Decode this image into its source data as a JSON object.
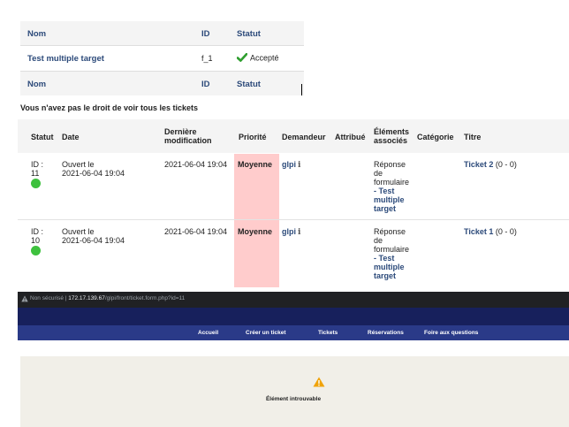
{
  "form_targets": {
    "header": {
      "name": "Nom",
      "id": "ID",
      "status": "Statut"
    },
    "rows": [
      {
        "name": "Test multiple target",
        "id": "f_1",
        "status": "Accepté"
      }
    ],
    "footer": {
      "name": "Nom",
      "id": "ID",
      "status": "Statut"
    }
  },
  "ticket_list": {
    "notice": "Vous n'avez pas le droit de voir tous les tickets",
    "columns": {
      "statut": "Statut",
      "date": "Date",
      "last_mod_1": "Dernière",
      "last_mod_2": "modification",
      "priority": "Priorité",
      "requester": "Demandeur",
      "assigned": "Attribué",
      "assoc_1": "Éléments",
      "assoc_2": "associés",
      "category": "Catégorie",
      "title": "Titre"
    },
    "rows": [
      {
        "id_label": "ID :",
        "id": "11",
        "status_color": "#3ec13e",
        "opened_label": "Ouvert le",
        "opened_date": "2021-06-04 19:04",
        "last_modified": "2021-06-04 19:04",
        "priority": "Moyenne",
        "requester": "glpi",
        "elements": [
          "Réponse",
          "de",
          "formulaire"
        ],
        "element_link": [
          "- Test",
          "multiple",
          "target"
        ],
        "title": "Ticket 2",
        "counts": "(0 - 0)"
      },
      {
        "id_label": "ID :",
        "id": "10",
        "status_color": "#3ec13e",
        "opened_label": "Ouvert le",
        "opened_date": "2021-06-04 19:04",
        "last_modified": "2021-06-04 19:04",
        "priority": "Moyenne",
        "requester": "glpi",
        "elements": [
          "Réponse",
          "de",
          "formulaire"
        ],
        "element_link": [
          "- Test",
          "multiple",
          "target"
        ],
        "title": "Ticket 1",
        "counts": "(0 - 0)"
      }
    ]
  },
  "browser": {
    "security": "Non sécurisé",
    "separator": "|",
    "host": "172.17.139.67",
    "path": "/glpi/front/ticket.form.php?id=11",
    "nav": [
      "Accueil",
      "Créer un ticket",
      "Tickets",
      "Réservations",
      "Foire aux questions"
    ],
    "message": "Élément introuvable",
    "colors": {
      "header": "#17205c",
      "navbar": "#2a3a88",
      "message_bg": "#f1efe8",
      "warning": "#f0a30a"
    }
  }
}
